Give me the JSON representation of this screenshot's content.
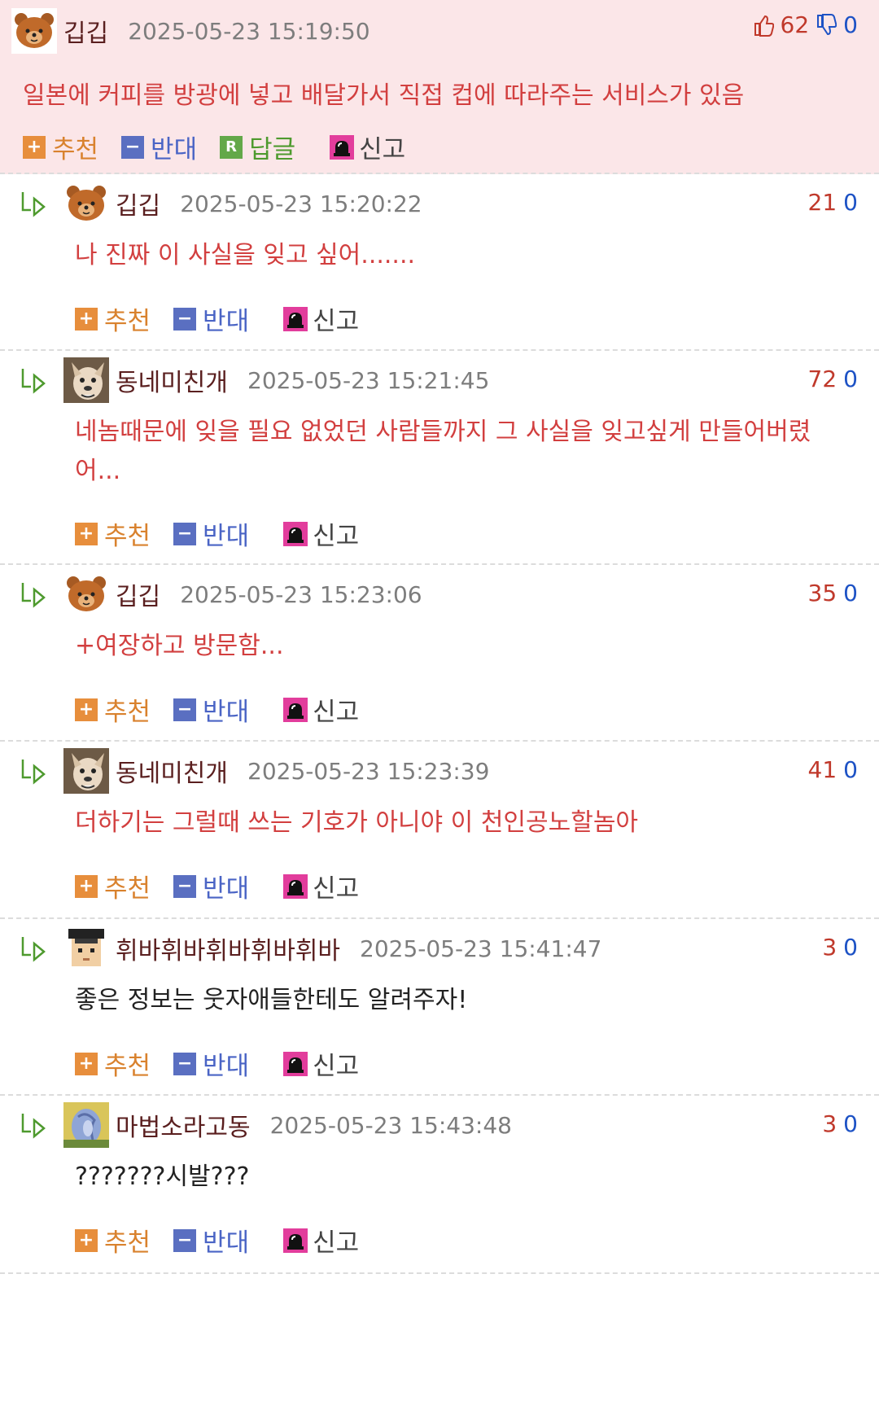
{
  "actions": {
    "recommend": "추천",
    "oppose": "반대",
    "reply": "답글",
    "report": "신고"
  },
  "main_comment": {
    "nick": "깁깁",
    "avatar": "bear-avatar",
    "date": "2025-05-23 15:19:50",
    "up": "62",
    "down": "0",
    "text": "일본에 커피를 방광에 넣고 배달가서 직접 컵에 따라주는 서비스가 있음"
  },
  "replies": [
    {
      "nick": "깁깁",
      "avatar": "bear-avatar",
      "date": "2025-05-23 15:20:22",
      "up": "21",
      "down": "0",
      "text": "나 진짜 이 사실을 잊고 싶어.......",
      "text_color": "red"
    },
    {
      "nick": "동네미친개",
      "avatar": "dog-avatar",
      "date": "2025-05-23 15:21:45",
      "up": "72",
      "down": "0",
      "text": "네놈때문에 잊을 필요 없었던 사람들까지 그 사실을 잊고싶게 만들어버렸 어...",
      "text_color": "red"
    },
    {
      "nick": "깁깁",
      "avatar": "bear-avatar",
      "date": "2025-05-23 15:23:06",
      "up": "35",
      "down": "0",
      "text": "+여장하고 방문함...",
      "text_color": "red"
    },
    {
      "nick": "동네미친개",
      "avatar": "dog-avatar",
      "date": "2025-05-23 15:23:39",
      "up": "41",
      "down": "0",
      "text": "더하기는 그럴때 쓰는 기호가 아니야 이 천인공노할놈아",
      "text_color": "red"
    },
    {
      "nick": "휘바휘바휘바휘바휘바",
      "avatar": "pixel-face-avatar",
      "date": "2025-05-23 15:41:47",
      "up": "3",
      "down": "0",
      "text": "좋은 정보는 웃자애들한테도 알려주자!",
      "text_color": "black"
    },
    {
      "nick": "마법소라고동",
      "avatar": "conch-avatar",
      "date": "2025-05-23 15:43:48",
      "up": "3",
      "down": "0",
      "text": "???????시발???",
      "text_color": "black"
    }
  ],
  "colors": {
    "top_bg": "#fbe6e8",
    "accent_red": "#d23f3f",
    "down_blue": "#1d52c5"
  }
}
